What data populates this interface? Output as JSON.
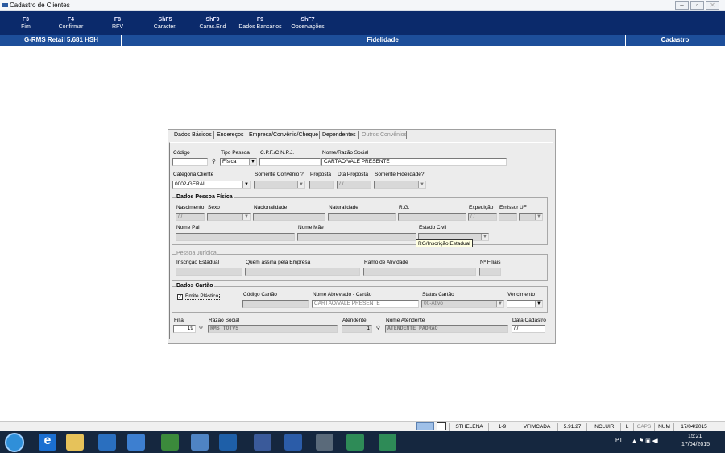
{
  "window": {
    "title": "Cadastro de Clientes"
  },
  "fkeys": [
    {
      "key": "F3",
      "label": "Fim"
    },
    {
      "key": "F4",
      "label": "Confirmar"
    },
    {
      "key": "F8",
      "label": "RFV"
    },
    {
      "key": "ShF5",
      "label": "Caracter."
    },
    {
      "key": "ShF9",
      "label": "Carac.End"
    },
    {
      "key": "F9",
      "label": "Dados Bancários"
    },
    {
      "key": "ShF7",
      "label": "Observações"
    }
  ],
  "infobar": {
    "app": "G-RMS Retail 5.681 HSH",
    "module": "Fidelidade",
    "screen": "Cadastro"
  },
  "tabs": [
    "Dados Básicos",
    "Endereços",
    "Empresa/Convênio/Cheque",
    "Dependentes",
    "Outros Convênios"
  ],
  "basic": {
    "codigo_label": "Código",
    "codigo_value": "",
    "tipo_pessoa_label": "Tipo Pessoa",
    "tipo_pessoa_value": "Física",
    "cpf_label": "C.P.F./C.N.P.J.",
    "cpf_value": "",
    "nome_label": "Nome/Razão Social",
    "nome_value": "CARTÃO/VALE PRESENTE",
    "categoria_label": "Categoria Cliente",
    "categoria_value": "0002-GERAL",
    "somente_convenio_label": "Somente Convênio ?",
    "somente_convenio_value": "",
    "proposta_label": "Proposta",
    "proposta_value": "",
    "dta_proposta_label": "Dta Proposta",
    "dta_proposta_value": "/ /",
    "somente_fidelidade_label": "Somente Fidelidade?",
    "somente_fidelidade_value": ""
  },
  "pf": {
    "title": "Dados Pessoa Física",
    "nascimento_label": "Nascimento",
    "nascimento_value": "/ /",
    "sexo_label": "Sexo",
    "nacionalidade_label": "Nacionalidade",
    "naturalidade_label": "Naturalidade",
    "rg_label": "R.G.",
    "expedicao_label": "Expedição",
    "expedicao_value": "/ /",
    "emissor_label": "Emissor",
    "uf_label": "UF",
    "nome_pai_label": "Nome Pai",
    "nome_mae_label": "Nome Mãe",
    "estado_civil_label": "Estado Civil",
    "tooltip": "RG/Inscrição Estadual"
  },
  "pj": {
    "title": "Pessoa Jurídica",
    "inscricao_label": "Inscrição Estadual",
    "quem_assina_label": "Quem assina pela Empresa",
    "ramo_label": "Ramo de Atividade",
    "filiais_label": "Nº Filiais"
  },
  "cartao": {
    "title": "Dados Cartão",
    "emite_label": "Emite Plástico",
    "emite_checked": "✓",
    "codigo_label": "Código Cartão",
    "nome_abrev_label": "Nome Abreviado - Cartão",
    "nome_abrev_value": "CARTÃO/VALE PRESENTE",
    "status_label": "Status Cartão",
    "status_value": "00-Ativo",
    "vencimento_label": "Vencimento"
  },
  "footer": {
    "filial_label": "Filial",
    "filial_value": "19",
    "razao_label": "Razão Social",
    "razao_value": "RMS TOTVS",
    "atendente_label": "Atendente",
    "atendente_value": "1",
    "nome_atendente_label": "Nome Atendente",
    "nome_atendente_value": "ATENDENTE PADRAO",
    "data_cadastro_label": "Data Cadastro",
    "data_cadastro_value": "/ /"
  },
  "statusbar": {
    "user": "STHELENA",
    "range": "1-9",
    "program": "VFIMCADA",
    "version": "5.91.27",
    "mode": "INCLUIR",
    "l": "L",
    "caps": "CAPS",
    "num": "NUM",
    "date": "17/04/2015"
  },
  "taskbar": {
    "lang": "PT",
    "time": "15:21",
    "date": "17/04/2015"
  }
}
